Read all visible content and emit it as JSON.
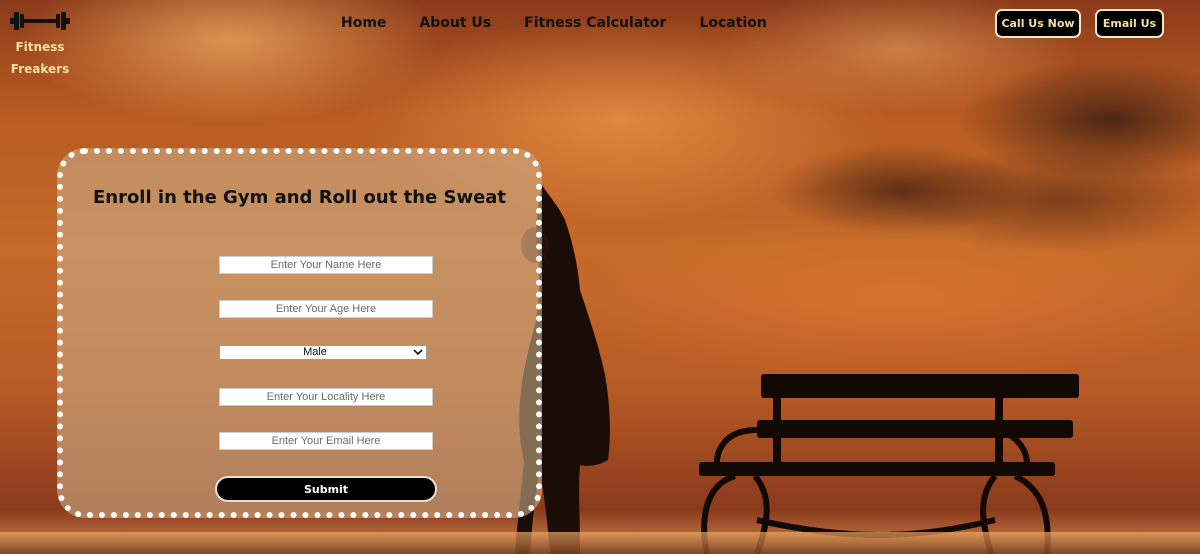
{
  "brand": {
    "name_line1": "Fitness",
    "name_line2": "Freakers",
    "icon": "dumbbell-icon",
    "color": "#f3e0a0"
  },
  "nav": {
    "items": [
      {
        "label": "Home"
      },
      {
        "label": "About Us"
      },
      {
        "label": "Fitness Calculator"
      },
      {
        "label": "Location"
      }
    ]
  },
  "header_buttons": {
    "call_label": "Call Us Now",
    "email_label": "Email Us"
  },
  "form": {
    "title": "Enroll in the Gym and Roll out the Sweat",
    "name_placeholder": "Enter Your Name Here",
    "age_placeholder": "Enter Your Age Here",
    "gender_selected": "Male",
    "locality_placeholder": "Enter Your Locality Here",
    "email_placeholder": "Enter Your Email Here",
    "submit_label": "Submit"
  }
}
